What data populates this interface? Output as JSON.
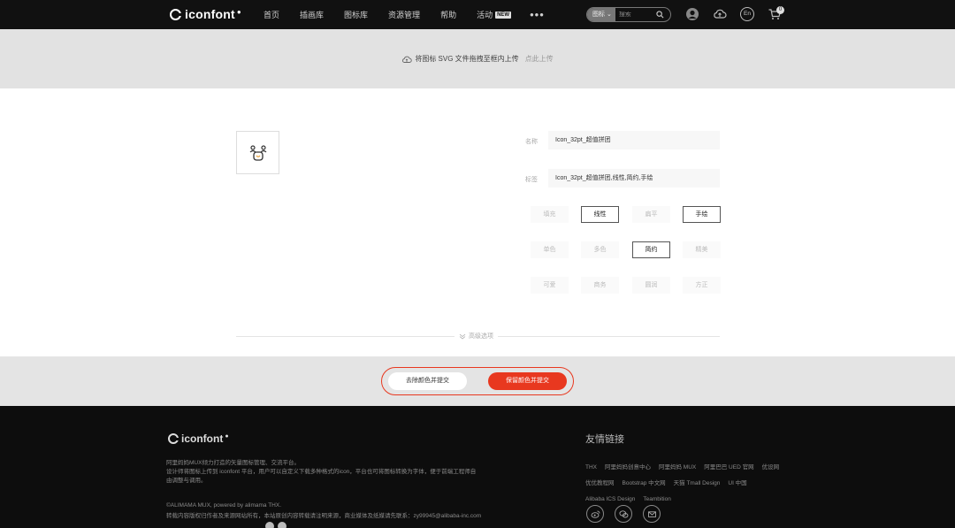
{
  "header": {
    "logo_text": "iconfont",
    "nav": [
      "首页",
      "插画库",
      "图标库",
      "资源管理",
      "帮助",
      "活动"
    ],
    "new_badge": "NEW",
    "more": "•••",
    "search_type": "图标",
    "search_placeholder": "搜索",
    "cart_count": "0",
    "lang_label": "En"
  },
  "upload": {
    "text": "将图标 SVG 文件拖拽至框内上传",
    "link": "点此上传"
  },
  "edit": {
    "name_label": "名称",
    "name_value": "Icon_32pt_超值拼团",
    "tags_label": "标签",
    "tags_value": "Icon_32pt_超值拼团,线性,简约,手绘",
    "style_tags": [
      {
        "label": "填充",
        "selected": false
      },
      {
        "label": "线性",
        "selected": true
      },
      {
        "label": "扁平",
        "selected": false
      },
      {
        "label": "手绘",
        "selected": true
      },
      {
        "label": "单色",
        "selected": false
      },
      {
        "label": "多色",
        "selected": false
      },
      {
        "label": "简约",
        "selected": true
      },
      {
        "label": "精美",
        "selected": false
      },
      {
        "label": "可爱",
        "selected": false
      },
      {
        "label": "商务",
        "selected": false
      },
      {
        "label": "圆润",
        "selected": false
      },
      {
        "label": "方正",
        "selected": false
      }
    ],
    "more_options": "高级选项"
  },
  "actions": {
    "strip_color": "去除颜色并提交",
    "keep_color": "保留颜色并提交"
  },
  "footer": {
    "logo_text": "iconfont",
    "line1": "阿里妈妈MUX倾力打造的矢量图标管理、交流平台。",
    "line2": "设计师将图标上传到 iconfont 平台，用户可以自定义下载多种格式的icon，平台也可将图标转换为字体，便于前端工程师自",
    "line3": "由调整与调用。",
    "line4": "©ALIMAMA MUX, powered by alimama THX.",
    "line5": "转载内容版权归作者及来源网站所有，本站原创内容转载请注明来源，商业媒体及纸媒请先联系：zy99945@alibaba-inc.com",
    "links_title": "友情链接",
    "links": [
      "THX",
      "阿里妈妈创意中心",
      "阿里妈妈 MUX",
      "阿里巴巴 UED 官网",
      "优设网",
      "优优教程网",
      "Bootstrap 中文网",
      "天猫 Tmall Design",
      "UI 中国",
      "Alibaba ICS Design",
      "Teambition"
    ]
  },
  "colors": {
    "accent": "#e8381f",
    "topbar": "#111111",
    "footer": "#0d0d0d"
  }
}
